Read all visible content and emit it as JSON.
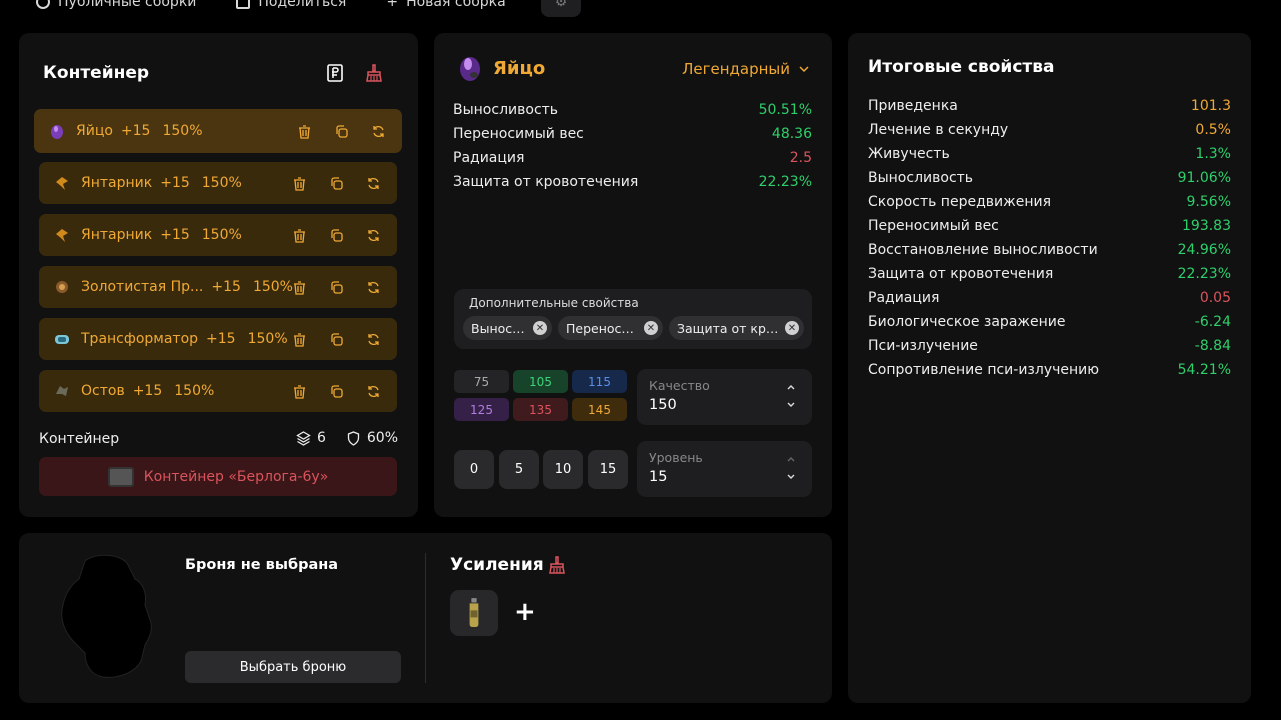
{
  "topnav": {
    "items": [
      {
        "label": "Публичные сборки",
        "icon": "globe-icon"
      },
      {
        "label": "Поделиться",
        "icon": "share-icon"
      },
      {
        "label": "Новая сборка",
        "icon": "plus-icon"
      }
    ],
    "settings_icon": "gear-icon"
  },
  "container": {
    "title": "Контейнер",
    "header_icons": [
      "ruble-icon",
      "broom-icon"
    ],
    "slots": [
      {
        "name": "Яйцо",
        "level": "+15",
        "quality": "150%",
        "icon": "egg-icon",
        "selected": true
      },
      {
        "name": "Янтарник",
        "level": "+15",
        "quality": "150%",
        "icon": "amber-icon"
      },
      {
        "name": "Янтарник",
        "level": "+15",
        "quality": "150%",
        "icon": "amber-icon"
      },
      {
        "name": "Золотистая Пр...",
        "level": "+15",
        "quality": "150%",
        "icon": "golden-icon"
      },
      {
        "name": "Трансформатор",
        "level": "+15",
        "quality": "150%",
        "icon": "transformer-icon"
      },
      {
        "name": "Остов",
        "level": "+15",
        "quality": "150%",
        "icon": "frame-icon"
      }
    ],
    "footer_label": "Контейнер",
    "slots_count": "6",
    "protection": "60%",
    "container_button": "Контейнер «Берлога-6у»"
  },
  "artifact": {
    "name": "Яйцо",
    "rarity": "Легендарный",
    "stats": [
      {
        "label": "Выносливость",
        "value": "50.51%",
        "color": "#2fcf6b"
      },
      {
        "label": "Переносимый вес",
        "value": "48.36",
        "color": "#2fcf6b"
      },
      {
        "label": "Радиация",
        "value": "2.5",
        "color": "#d9545c"
      },
      {
        "label": "Защита от кровотечения",
        "value": "22.23%",
        "color": "#2fcf6b"
      }
    ],
    "extra_title": "Дополнительные свойства",
    "extra_chips": [
      "Выносливость",
      "Переносимый вес",
      "Защита от кровотечения"
    ],
    "quality_presets": [
      {
        "value": "75",
        "bg": "#242426",
        "fg": "#aaaaaa"
      },
      {
        "value": "105",
        "bg": "#17432a",
        "fg": "#3fd27a"
      },
      {
        "value": "115",
        "bg": "#16294a",
        "fg": "#5b8fe6"
      },
      {
        "value": "125",
        "bg": "#352147",
        "fg": "#b07ee0"
      },
      {
        "value": "135",
        "bg": "#3f1b1d",
        "fg": "#d9545c"
      },
      {
        "value": "145",
        "bg": "#3e2c0d",
        "fg": "#f0a935"
      }
    ],
    "quality_label": "Качество",
    "quality_value": "150",
    "level_presets": [
      "0",
      "5",
      "10",
      "15"
    ],
    "level_label": "Уровень",
    "level_value": "15"
  },
  "result": {
    "title": "Итоговые свойства",
    "stats": [
      {
        "label": "Приведенка",
        "value": "101.3",
        "color": "#f0a935"
      },
      {
        "label": "Лечение в секунду",
        "value": "0.5%",
        "color": "#f0a935"
      },
      {
        "label": "Живучесть",
        "value": "1.3%",
        "color": "#2fcf6b"
      },
      {
        "label": "Выносливость",
        "value": "91.06%",
        "color": "#2fcf6b"
      },
      {
        "label": "Скорость передвижения",
        "value": "9.56%",
        "color": "#2fcf6b"
      },
      {
        "label": "Переносимый вес",
        "value": "193.83",
        "color": "#2fcf6b"
      },
      {
        "label": "Восстановление выносливости",
        "value": "24.96%",
        "color": "#2fcf6b"
      },
      {
        "label": "Защита от кровотечения",
        "value": "22.23%",
        "color": "#2fcf6b"
      },
      {
        "label": "Радиация",
        "value": "0.05",
        "color": "#d9545c"
      },
      {
        "label": "Биологическое заражение",
        "value": "-6.24",
        "color": "#2fcf6b"
      },
      {
        "label": "Пси-излучение",
        "value": "-8.84",
        "color": "#2fcf6b"
      },
      {
        "label": "Сопротивление пси-излучению",
        "value": "54.21%",
        "color": "#2fcf6b"
      }
    ]
  },
  "armor": {
    "none_label": "Броня не выбрана",
    "select_button": "Выбрать броню",
    "boosts_title": "Усиления",
    "add_symbol": "+"
  }
}
